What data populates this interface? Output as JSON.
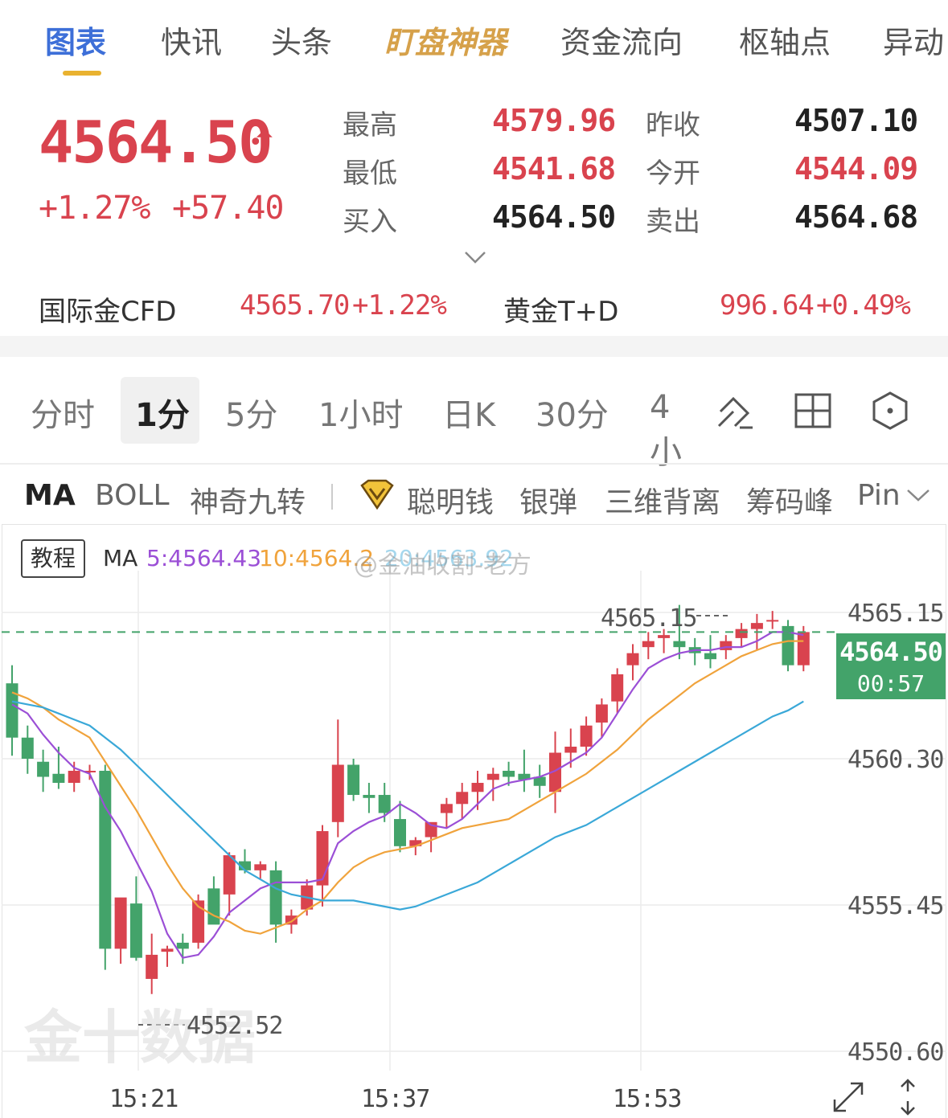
{
  "nav": {
    "tabs": [
      {
        "label": "图表",
        "active": true
      },
      {
        "label": "快讯",
        "active": false
      },
      {
        "label": "头条",
        "active": false
      },
      {
        "label": "盯盘神器",
        "active": false,
        "special": true
      },
      {
        "label": "资金流向",
        "active": false
      },
      {
        "label": "枢轴点",
        "active": false
      },
      {
        "label": "异动",
        "active": false
      }
    ]
  },
  "quote": {
    "price": "4564.50",
    "change_pct": "+1.27%",
    "change_abs": "+57.40",
    "stats": {
      "high_label": "最高",
      "high": "4579.96",
      "low_label": "最低",
      "low": "4541.68",
      "bid_label": "买入",
      "bid": "4564.50",
      "prev_close_label": "昨收",
      "prev_close": "4507.10",
      "open_label": "今开",
      "open": "4544.09",
      "ask_label": "卖出",
      "ask": "4564.68"
    },
    "related": [
      {
        "name": "国际金CFD",
        "price": "4565.70",
        "pct": "+1.22%"
      },
      {
        "name": "黄金T+D",
        "price": "996.64",
        "pct": "+0.49%"
      }
    ]
  },
  "timeframes": [
    {
      "label": "分时",
      "active": false
    },
    {
      "label": "1分",
      "active": true
    },
    {
      "label": "5分",
      "active": false
    },
    {
      "label": "1小时",
      "active": false
    },
    {
      "label": "日K",
      "active": false
    },
    {
      "label": "30分",
      "active": false
    },
    {
      "label": "4小",
      "active": false
    }
  ],
  "indicators": [
    {
      "label": "MA",
      "active": true
    },
    {
      "label": "BOLL",
      "active": false
    },
    {
      "label": "神奇九转",
      "active": false
    },
    {
      "label": "聪明钱",
      "active": false
    },
    {
      "label": "银弹",
      "active": false
    },
    {
      "label": "三维背离",
      "active": false
    },
    {
      "label": "筹码峰",
      "active": false
    },
    {
      "label": "Pin",
      "active": false
    }
  ],
  "legend": {
    "tutorial": "教程",
    "ma": "MA",
    "ma5": "5:4564.43",
    "ma10": "10:4564.2",
    "ma20": "20:4563.92"
  },
  "watermark": "@金油收割-老方",
  "brand_watermark": "金十数据",
  "colors": {
    "up": "#d9434e",
    "down": "#43a36a",
    "ma5": "#9b4fd6",
    "ma10": "#f0a33c",
    "ma20": "#3aa8d8",
    "accent": "#3d6fd8",
    "tab_underline": "#e9b230"
  },
  "chart_data": {
    "type": "candlestick",
    "ylim": [
      4549.5,
      4567.2
    ],
    "y_ticks": [
      "4565.15",
      "4560.30",
      "4555.45",
      "4550.60"
    ],
    "x_ticks": [
      "15:21",
      "15:37",
      "15:53"
    ],
    "current_price": "4564.50",
    "countdown": "00:57",
    "high_mark": "4565.15",
    "low_mark": "4552.52",
    "candles": [
      [
        4562.8,
        4563.4,
        4560.4,
        4561.0
      ],
      [
        4561.0,
        4561.4,
        4559.8,
        4560.3
      ],
      [
        4560.2,
        4560.6,
        4559.2,
        4559.7
      ],
      [
        4559.8,
        4560.7,
        4559.3,
        4559.5
      ],
      [
        4559.5,
        4560.2,
        4559.2,
        4559.9
      ],
      [
        4559.9,
        4560.1,
        4559.6,
        4559.9
      ],
      [
        4559.9,
        4560.1,
        4553.3,
        4554.0
      ],
      [
        4554.0,
        4555.4,
        4553.5,
        4555.7
      ],
      [
        4555.5,
        4556.4,
        4553.6,
        4553.7
      ],
      [
        4553.0,
        4554.5,
        4552.5,
        4553.8
      ],
      [
        4553.9,
        4554.1,
        4553.4,
        4554.0
      ],
      [
        4554.2,
        4554.5,
        4553.5,
        4554.0
      ],
      [
        4554.2,
        4555.8,
        4554.0,
        4555.6
      ],
      [
        4556.0,
        4556.4,
        4555.0,
        4554.8
      ],
      [
        4555.8,
        4557.2,
        4555.1,
        4557.1
      ],
      [
        4556.9,
        4557.3,
        4556.5,
        4556.6
      ],
      [
        4556.6,
        4556.9,
        4556.3,
        4556.8
      ],
      [
        4556.6,
        4556.9,
        4554.2,
        4554.8
      ],
      [
        4554.8,
        4555.3,
        4554.5,
        4555.1
      ],
      [
        4555.3,
        4556.3,
        4555.1,
        4556.1
      ],
      [
        4556.1,
        4558.1,
        4555.4,
        4557.9
      ],
      [
        4558.2,
        4561.6,
        4557.7,
        4560.1
      ],
      [
        4560.1,
        4560.3,
        4558.9,
        4559.1
      ],
      [
        4559.1,
        4559.5,
        4558.5,
        4559.0
      ],
      [
        4559.1,
        4559.5,
        4558.2,
        4558.5
      ],
      [
        4558.3,
        4558.9,
        4557.2,
        4557.4
      ],
      [
        4557.4,
        4557.7,
        4557.1,
        4557.6
      ],
      [
        4557.7,
        4558.1,
        4557.2,
        4558.2
      ],
      [
        4558.5,
        4559.0,
        4558.0,
        4558.8
      ],
      [
        4558.8,
        4559.5,
        4558.3,
        4559.2
      ],
      [
        4559.2,
        4559.9,
        4558.6,
        4559.5
      ],
      [
        4559.6,
        4560.0,
        4558.9,
        4559.8
      ],
      [
        4559.9,
        4560.2,
        4559.4,
        4559.7
      ],
      [
        4559.8,
        4560.6,
        4559.2,
        4559.6
      ],
      [
        4559.7,
        4560.1,
        4559.0,
        4559.4
      ],
      [
        4559.2,
        4561.2,
        4558.5,
        4560.5
      ],
      [
        4560.5,
        4561.3,
        4560.0,
        4560.7
      ],
      [
        4560.7,
        4561.7,
        4560.4,
        4561.4
      ],
      [
        4561.5,
        4562.3,
        4561.0,
        4562.1
      ],
      [
        4562.2,
        4563.3,
        4561.8,
        4563.1
      ],
      [
        4563.4,
        4564.1,
        4562.9,
        4563.8
      ],
      [
        4564.0,
        4564.5,
        4563.6,
        4564.2
      ],
      [
        4564.3,
        4564.6,
        4563.8,
        4564.4
      ],
      [
        4564.2,
        4565.4,
        4563.6,
        4564.0
      ],
      [
        4564.0,
        4564.3,
        4563.4,
        4563.8
      ],
      [
        4563.8,
        4564.4,
        4563.3,
        4563.6
      ],
      [
        4563.9,
        4564.4,
        4563.6,
        4564.2
      ],
      [
        4564.3,
        4564.8,
        4564.0,
        4564.6
      ],
      [
        4564.6,
        4565.1,
        4563.9,
        4564.8
      ],
      [
        4564.9,
        4565.2,
        4564.6,
        4564.9
      ],
      [
        4564.7,
        4564.9,
        4563.2,
        4563.4
      ],
      [
        4563.4,
        4564.7,
        4563.2,
        4564.5
      ]
    ],
    "series": [
      {
        "name": "MA5",
        "values": [
          4562.1,
          4561.8,
          4561.1,
          4560.5,
          4560.0,
          4559.8,
          4558.7,
          4557.9,
          4556.9,
          4555.9,
          4554.5,
          4553.7,
          4553.8,
          4554.4,
          4555.2,
          4555.6,
          4556.0,
          4556.2,
          4556.2,
          4556.2,
          4556.3,
          4557.5,
          4557.9,
          4558.2,
          4558.4,
          4558.8,
          4558.5,
          4558.1,
          4558.0,
          4558.3,
          4558.8,
          4559.3,
          4559.5,
          4559.6,
          4559.7,
          4559.9,
          4560.2,
          4560.5,
          4561.0,
          4561.8,
          4562.6,
          4563.3,
          4563.6,
          4563.8,
          4563.9,
          4563.9,
          4564.0,
          4564.0,
          4564.2,
          4564.5,
          4564.5,
          4564.4
        ]
      },
      {
        "name": "MA10",
        "values": [
          4562.5,
          4562.3,
          4562.0,
          4561.6,
          4561.3,
          4561.0,
          4560.2,
          4559.4,
          4558.6,
          4557.7,
          4556.8,
          4556.0,
          4555.4,
          4555.1,
          4554.9,
          4554.6,
          4554.5,
          4554.7,
          4554.9,
          4555.3,
          4555.6,
          4556.2,
          4556.7,
          4557.0,
          4557.2,
          4557.3,
          4557.4,
          4557.6,
          4557.8,
          4558.0,
          4558.1,
          4558.2,
          4558.3,
          4558.6,
          4558.9,
          4559.2,
          4559.5,
          4559.8,
          4560.2,
          4560.6,
          4561.1,
          4561.6,
          4562.0,
          4562.4,
          4562.8,
          4563.1,
          4563.4,
          4563.7,
          4563.9,
          4564.1,
          4564.2,
          4564.2
        ]
      },
      {
        "name": "MA20",
        "values": [
          4562.2,
          4562.1,
          4562.0,
          4561.8,
          4561.6,
          4561.4,
          4561.0,
          4560.6,
          4560.1,
          4559.6,
          4559.1,
          4558.6,
          4558.1,
          4557.6,
          4557.1,
          4556.6,
          4556.3,
          4556.0,
          4555.8,
          4555.7,
          4555.6,
          4555.6,
          4555.6,
          4555.5,
          4555.4,
          4555.3,
          4555.4,
          4555.6,
          4555.8,
          4556.0,
          4556.2,
          4556.5,
          4556.8,
          4557.1,
          4557.4,
          4557.7,
          4557.9,
          4558.1,
          4558.4,
          4558.7,
          4559.0,
          4559.3,
          4559.6,
          4559.9,
          4560.2,
          4560.5,
          4560.8,
          4561.1,
          4561.4,
          4561.7,
          4561.9,
          4562.2
        ]
      }
    ]
  }
}
